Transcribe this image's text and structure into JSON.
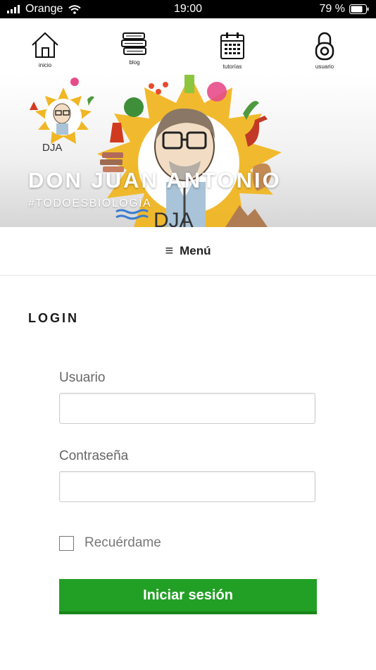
{
  "status_bar": {
    "carrier": "Orange",
    "time": "19:00",
    "battery": "79 %"
  },
  "topnav": {
    "items": [
      {
        "label": "inicio",
        "icon": "home-icon"
      },
      {
        "label": "blog",
        "icon": "books-icon"
      },
      {
        "label": "tutorías",
        "icon": "calendar-icon"
      },
      {
        "label": "usuario",
        "icon": "lock-icon"
      }
    ]
  },
  "header": {
    "title": "DON JUAN ANTONIO",
    "tagline": "#TODOESBIOLOGÍA",
    "logo_text": "DJA"
  },
  "menu": {
    "label": "Menú"
  },
  "login": {
    "title": "LOGIN",
    "username_label": "Usuario",
    "username_value": "",
    "password_label": "Contraseña",
    "password_value": "",
    "remember_label": "Recuérdame",
    "remember_checked": false,
    "submit_label": "Iniciar sesión"
  },
  "colors": {
    "accent": "#22a025",
    "accent_dark": "#17851a",
    "title_text": "#ffffff"
  }
}
